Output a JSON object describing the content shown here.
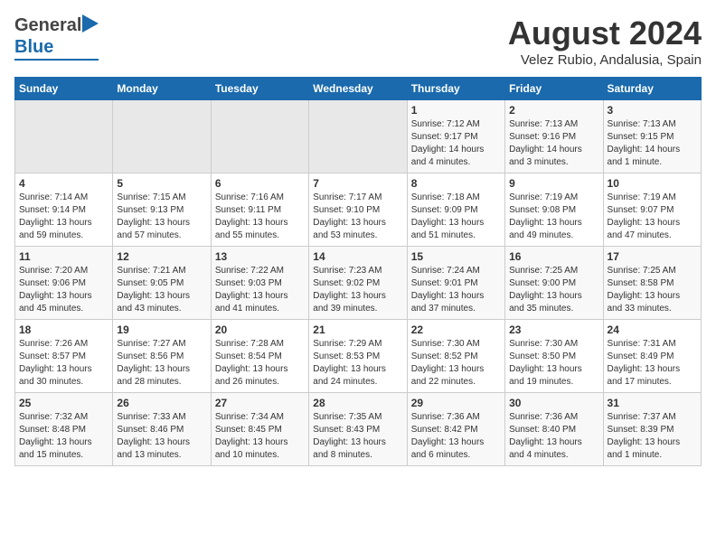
{
  "header": {
    "logo_general": "General",
    "logo_blue": "Blue",
    "title": "August 2024",
    "subtitle": "Velez Rubio, Andalusia, Spain"
  },
  "calendar": {
    "days_of_week": [
      "Sunday",
      "Monday",
      "Tuesday",
      "Wednesday",
      "Thursday",
      "Friday",
      "Saturday"
    ],
    "weeks": [
      [
        {
          "day": "",
          "info": ""
        },
        {
          "day": "",
          "info": ""
        },
        {
          "day": "",
          "info": ""
        },
        {
          "day": "",
          "info": ""
        },
        {
          "day": "1",
          "info": "Sunrise: 7:12 AM\nSunset: 9:17 PM\nDaylight: 14 hours and 4 minutes."
        },
        {
          "day": "2",
          "info": "Sunrise: 7:13 AM\nSunset: 9:16 PM\nDaylight: 14 hours and 3 minutes."
        },
        {
          "day": "3",
          "info": "Sunrise: 7:13 AM\nSunset: 9:15 PM\nDaylight: 14 hours and 1 minute."
        }
      ],
      [
        {
          "day": "4",
          "info": "Sunrise: 7:14 AM\nSunset: 9:14 PM\nDaylight: 13 hours and 59 minutes."
        },
        {
          "day": "5",
          "info": "Sunrise: 7:15 AM\nSunset: 9:13 PM\nDaylight: 13 hours and 57 minutes."
        },
        {
          "day": "6",
          "info": "Sunrise: 7:16 AM\nSunset: 9:11 PM\nDaylight: 13 hours and 55 minutes."
        },
        {
          "day": "7",
          "info": "Sunrise: 7:17 AM\nSunset: 9:10 PM\nDaylight: 13 hours and 53 minutes."
        },
        {
          "day": "8",
          "info": "Sunrise: 7:18 AM\nSunset: 9:09 PM\nDaylight: 13 hours and 51 minutes."
        },
        {
          "day": "9",
          "info": "Sunrise: 7:19 AM\nSunset: 9:08 PM\nDaylight: 13 hours and 49 minutes."
        },
        {
          "day": "10",
          "info": "Sunrise: 7:19 AM\nSunset: 9:07 PM\nDaylight: 13 hours and 47 minutes."
        }
      ],
      [
        {
          "day": "11",
          "info": "Sunrise: 7:20 AM\nSunset: 9:06 PM\nDaylight: 13 hours and 45 minutes."
        },
        {
          "day": "12",
          "info": "Sunrise: 7:21 AM\nSunset: 9:05 PM\nDaylight: 13 hours and 43 minutes."
        },
        {
          "day": "13",
          "info": "Sunrise: 7:22 AM\nSunset: 9:03 PM\nDaylight: 13 hours and 41 minutes."
        },
        {
          "day": "14",
          "info": "Sunrise: 7:23 AM\nSunset: 9:02 PM\nDaylight: 13 hours and 39 minutes."
        },
        {
          "day": "15",
          "info": "Sunrise: 7:24 AM\nSunset: 9:01 PM\nDaylight: 13 hours and 37 minutes."
        },
        {
          "day": "16",
          "info": "Sunrise: 7:25 AM\nSunset: 9:00 PM\nDaylight: 13 hours and 35 minutes."
        },
        {
          "day": "17",
          "info": "Sunrise: 7:25 AM\nSunset: 8:58 PM\nDaylight: 13 hours and 33 minutes."
        }
      ],
      [
        {
          "day": "18",
          "info": "Sunrise: 7:26 AM\nSunset: 8:57 PM\nDaylight: 13 hours and 30 minutes."
        },
        {
          "day": "19",
          "info": "Sunrise: 7:27 AM\nSunset: 8:56 PM\nDaylight: 13 hours and 28 minutes."
        },
        {
          "day": "20",
          "info": "Sunrise: 7:28 AM\nSunset: 8:54 PM\nDaylight: 13 hours and 26 minutes."
        },
        {
          "day": "21",
          "info": "Sunrise: 7:29 AM\nSunset: 8:53 PM\nDaylight: 13 hours and 24 minutes."
        },
        {
          "day": "22",
          "info": "Sunrise: 7:30 AM\nSunset: 8:52 PM\nDaylight: 13 hours and 22 minutes."
        },
        {
          "day": "23",
          "info": "Sunrise: 7:30 AM\nSunset: 8:50 PM\nDaylight: 13 hours and 19 minutes."
        },
        {
          "day": "24",
          "info": "Sunrise: 7:31 AM\nSunset: 8:49 PM\nDaylight: 13 hours and 17 minutes."
        }
      ],
      [
        {
          "day": "25",
          "info": "Sunrise: 7:32 AM\nSunset: 8:48 PM\nDaylight: 13 hours and 15 minutes."
        },
        {
          "day": "26",
          "info": "Sunrise: 7:33 AM\nSunset: 8:46 PM\nDaylight: 13 hours and 13 minutes."
        },
        {
          "day": "27",
          "info": "Sunrise: 7:34 AM\nSunset: 8:45 PM\nDaylight: 13 hours and 10 minutes."
        },
        {
          "day": "28",
          "info": "Sunrise: 7:35 AM\nSunset: 8:43 PM\nDaylight: 13 hours and 8 minutes."
        },
        {
          "day": "29",
          "info": "Sunrise: 7:36 AM\nSunset: 8:42 PM\nDaylight: 13 hours and 6 minutes."
        },
        {
          "day": "30",
          "info": "Sunrise: 7:36 AM\nSunset: 8:40 PM\nDaylight: 13 hours and 4 minutes."
        },
        {
          "day": "31",
          "info": "Sunrise: 7:37 AM\nSunset: 8:39 PM\nDaylight: 13 hours and 1 minute."
        }
      ]
    ]
  }
}
